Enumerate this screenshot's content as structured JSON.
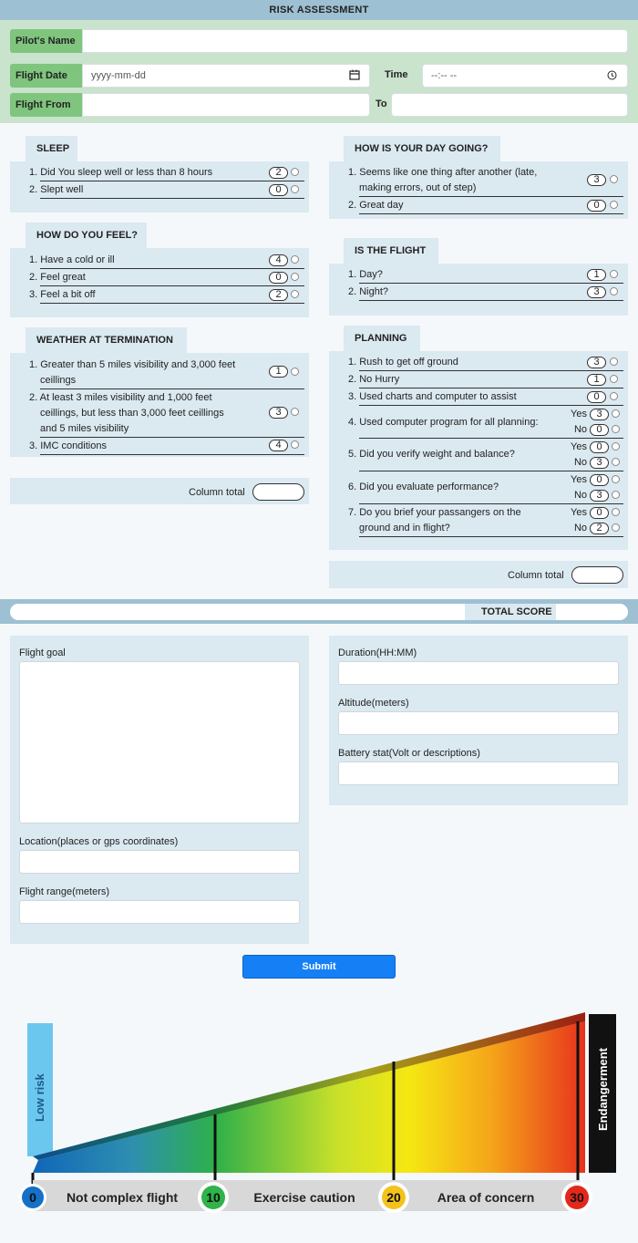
{
  "title": "RISK ASSESSMENT",
  "header": {
    "pilot_label": "Pilot's Name",
    "pilot_value": "",
    "flight_date_label": "Flight Date",
    "flight_date_placeholder": "yyyy-mm-dd",
    "time_label": "Time",
    "time_placeholder": "--:-- --",
    "flight_from_label": "Flight From",
    "to_label": "To"
  },
  "sleep": {
    "title": "SLEEP",
    "items": [
      {
        "text": "1. Did You sleep well or less than 8 hours",
        "score": "2"
      },
      {
        "text": "2. Slept well",
        "score": "0"
      }
    ]
  },
  "feel": {
    "title": "HOW DO YOU FEEL?",
    "items": [
      {
        "text": "1. Have a cold or ill",
        "score": "4"
      },
      {
        "text": "2. Feel great",
        "score": "0"
      },
      {
        "text": "3. Feel a bit off",
        "score": "2"
      }
    ]
  },
  "weather": {
    "title": "WEATHER AT TERMINATION",
    "items": [
      {
        "line1": "1. Greater than 5 miles visibility and 3,000 feet",
        "line2": "ceillings",
        "score": "1"
      },
      {
        "line1": "2. At least 3 miles visibility and 1,000 feet",
        "line2": "ceillings, but less than 3,000 feet ceillings",
        "line3": "and 5 miles visibility",
        "score": "3"
      },
      {
        "line1": "3. IMC conditions",
        "score": "4"
      }
    ]
  },
  "day": {
    "title": "HOW IS YOUR DAY GOING?",
    "items": [
      {
        "line1": "1. Seems like one thing after another (late,",
        "line2": "making errors, out of step)",
        "score": "3"
      },
      {
        "line1": "2. Great day",
        "score": "0"
      }
    ]
  },
  "flight": {
    "title": "IS THE FLIGHT",
    "items": [
      {
        "text": "1. Day?",
        "score": "1"
      },
      {
        "text": "2. Night?",
        "score": "3"
      }
    ]
  },
  "planning": {
    "title": "PLANNING",
    "items": [
      {
        "text": "1. Rush to get off ground",
        "score": "3"
      },
      {
        "text": "2. No Hurry",
        "score": "1"
      },
      {
        "text": "3. Used charts and computer to assist",
        "score": "0"
      },
      {
        "text": "4. Used computer program for all planning:",
        "yes": "3",
        "no": "0"
      },
      {
        "text": "5. Did you verify weight and balance?",
        "yes": "0",
        "no": "3"
      },
      {
        "text": "6. Did you evaluate performance?",
        "yes": "0",
        "no": "3"
      },
      {
        "line1": "7. Do you brief your passangers on the",
        "line2": "ground and in flight?",
        "yes": "0",
        "no": "2"
      }
    ]
  },
  "yes_label": "Yes",
  "no_label": "No",
  "column_total_label": "Column total",
  "total_score_label": "TOTAL SCORE",
  "form": {
    "flight_goal": "Flight goal",
    "location": "Location(places or gps coordinates)",
    "flight_range": "Flight range(meters)",
    "duration": "Duration(HH:MM)",
    "altitude": "Altitude(meters)",
    "battery": "Battery stat(Volt or descriptions)"
  },
  "submit_label": "Submit",
  "gauge": {
    "low_label": "Low risk",
    "high_label": "Endangerment",
    "markers": [
      "0",
      "10",
      "20",
      "30"
    ],
    "zones": [
      "Not complex flight",
      "Exercise caution",
      "Area of concern"
    ]
  },
  "colors": {
    "header_bar": "#9dc0d2",
    "label_green": "#7fc57e",
    "panel": "#dbe9f1",
    "submit": "#1580f5"
  }
}
